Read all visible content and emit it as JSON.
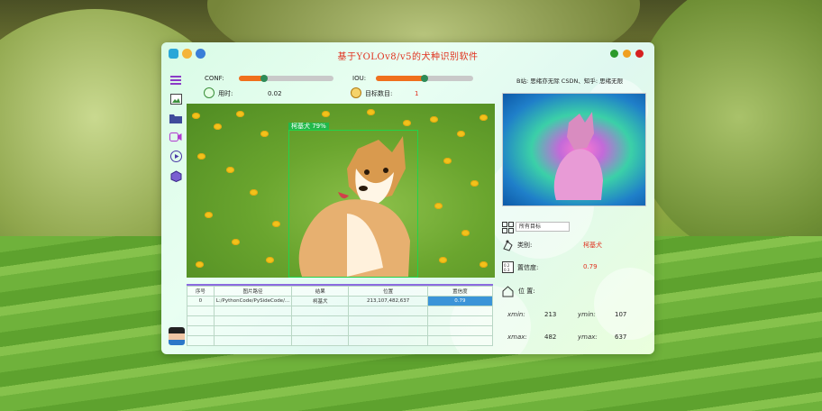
{
  "app": {
    "title": "基于YOLOv8/v5的犬种识别软件",
    "accent_title_color": "#e0301e",
    "window_dots": [
      "#2b9a2b",
      "#f0a020",
      "#d62020"
    ]
  },
  "controls": {
    "conf_label": "CONF:",
    "conf_value": 0.25,
    "iou_label": "IOU:",
    "iou_value": 0.5,
    "time_label": "用时:",
    "time_value": "0.02",
    "count_label": "目标数目:",
    "count_value": "1"
  },
  "detection": {
    "label": "柯基犬 79%"
  },
  "table": {
    "headers": [
      "序号",
      "图片路径",
      "结果",
      "位置",
      "置信度"
    ],
    "rows": [
      [
        "0",
        "L:/PythonCode/PySideCode/...",
        "柯基犬",
        "213,107,482,637",
        "0.79"
      ]
    ]
  },
  "right": {
    "credit": "B站: 思绪亦无际 CSDN、知乎: 思绪无限",
    "target_select": "所有目标",
    "class_label": "类别:",
    "class_value": "柯基犬",
    "conf_label": "置信度:",
    "conf_value": "0.79",
    "pos_label": "位 置:",
    "xmin_label": "xmin:",
    "xmin": "213",
    "ymin_label": "ymin:",
    "ymin": "107",
    "xmax_label": "xmax:",
    "xmax": "482",
    "ymax_label": "ymax:",
    "ymax": "637"
  },
  "sidebar": {
    "items": [
      "menu-icon",
      "image-icon",
      "folder-icon",
      "camera-icon",
      "play-icon",
      "model-icon"
    ]
  }
}
